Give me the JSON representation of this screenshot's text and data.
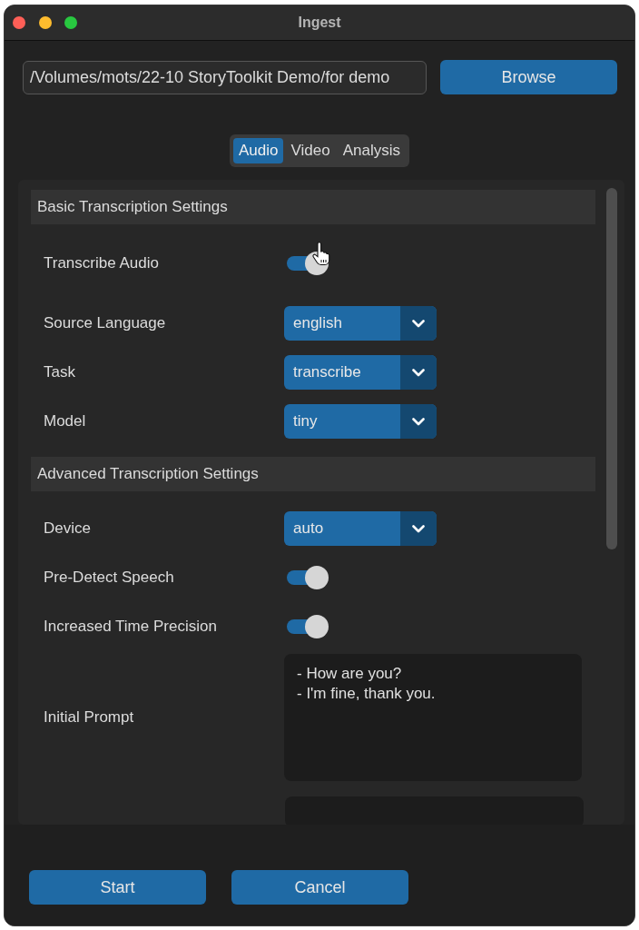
{
  "window": {
    "title": "Ingest"
  },
  "path_field": {
    "value": "/Volumes/mots/22-10 StoryToolkit Demo/for demo"
  },
  "browse_button": {
    "label": "Browse"
  },
  "tabs": [
    {
      "label": "Audio",
      "selected": true
    },
    {
      "label": "Video",
      "selected": false
    },
    {
      "label": "Analysis",
      "selected": false
    }
  ],
  "sections": [
    {
      "title": "Basic Transcription Settings",
      "rows": [
        {
          "kind": "switch",
          "label": "Transcribe Audio",
          "on": true,
          "hovered": true
        },
        {
          "kind": "dropdown",
          "label": "Source Language",
          "value": "english",
          "hovered": false
        },
        {
          "kind": "dropdown",
          "label": "Task",
          "value": "transcribe",
          "hovered": false
        },
        {
          "kind": "dropdown",
          "label": "Model",
          "value": "tiny",
          "hovered": false
        }
      ]
    },
    {
      "title": "Advanced Transcription Settings",
      "rows": [
        {
          "kind": "dropdown",
          "label": "Device",
          "value": "auto",
          "hovered": false
        },
        {
          "kind": "switch",
          "label": "Pre-Detect Speech",
          "on": true,
          "hovered": false
        },
        {
          "kind": "switch",
          "label": "Increased Time Precision",
          "on": true,
          "hovered": false
        },
        {
          "kind": "textarea",
          "label": "Initial Prompt",
          "value": "- How are you?\n- I'm fine, thank you.",
          "hovered": false
        },
        {
          "kind": "blank_field",
          "hovered": false
        }
      ]
    }
  ],
  "buttons": [
    {
      "label": "Start"
    },
    {
      "label": "Cancel"
    }
  ]
}
